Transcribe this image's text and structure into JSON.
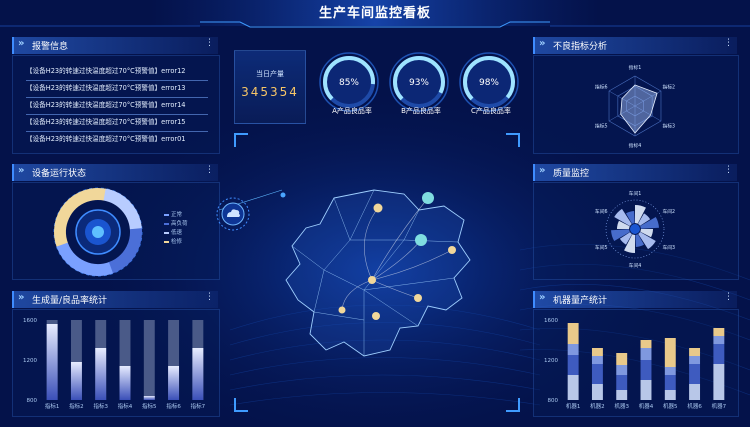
{
  "header": {
    "title": "生产车间监控看板"
  },
  "colors": {
    "bg": "#04124a",
    "accent": "#3f8cff",
    "gold": "#f7c667",
    "cyan": "#7fdde0",
    "bar_dark": "#4a5a88"
  },
  "alarm_panel": {
    "title": "报警信息",
    "items": [
      "【设备H23的转速过快温度超过70°C预警值】error12",
      "【设备H23的转速过快温度超过70°C预警值】error13",
      "【设备H23的转速过快温度超过70°C预警值】error14",
      "【设备H23的转速过快温度超过70°C预警值】error15",
      "【设备H23的转速过快温度超过70°C预警值】error01"
    ]
  },
  "kpi": {
    "label": "当日产量",
    "value": "345354"
  },
  "gauges": [
    {
      "value_text": "85%",
      "value": 85,
      "label": "A产品良品率"
    },
    {
      "value_text": "93%",
      "value": 93,
      "label": "B产品良品率"
    },
    {
      "value_text": "98%",
      "value": 98,
      "label": "C产品良品率"
    }
  ],
  "defect_panel": {
    "title": "不良指标分析",
    "labels": [
      "指标1",
      "指标2",
      "指标3",
      "指标4",
      "指标5",
      "指标6"
    ],
    "values": [
      0.7,
      0.85,
      0.6,
      0.9,
      0.55,
      0.5
    ]
  },
  "device_panel": {
    "title": "设备运行状态",
    "legend": [
      {
        "label": "正常",
        "color": "#7aa0ff"
      },
      {
        "label": "高负荷",
        "color": "#4b6fd8"
      },
      {
        "label": "低速",
        "color": "#b8ccff"
      },
      {
        "label": "检修",
        "color": "#f1d79a"
      }
    ]
  },
  "quality_panel": {
    "title": "质量监控",
    "labels": [
      "车间1",
      "车间2",
      "车间3",
      "车间4",
      "车间5",
      "车间6"
    ]
  },
  "production_panel": {
    "title": "生成量/良品率统计",
    "chart_data": {
      "type": "bar",
      "categories": [
        "指标1",
        "指标2",
        "指标3",
        "指标4",
        "指标5",
        "指标6",
        "指标7"
      ],
      "series": [
        {
          "values": [
            1560,
            1180,
            1320,
            1140,
            840,
            1140,
            1320
          ]
        }
      ],
      "ylim": [
        800,
        1600
      ],
      "yticks": [
        "1600",
        "1200",
        "800"
      ]
    }
  },
  "machine_panel": {
    "title": "机器量产统计",
    "chart_data": {
      "type": "bar",
      "stacked": true,
      "categories": [
        "机器1",
        "机器2",
        "机器3",
        "机器4",
        "机器5",
        "机器6",
        "机器7"
      ],
      "series": [
        {
          "values": [
            1050,
            960,
            900,
            1000,
            900,
            960,
            1160
          ]
        },
        {
          "values": [
            200,
            200,
            150,
            200,
            150,
            200,
            200
          ]
        },
        {
          "values": [
            110,
            80,
            100,
            120,
            80,
            80,
            80
          ]
        },
        {
          "values": [
            210,
            80,
            120,
            80,
            290,
            80,
            80
          ]
        }
      ],
      "ylim": [
        800,
        1600
      ],
      "yticks": [
        "1600",
        "1200",
        "800"
      ]
    }
  }
}
